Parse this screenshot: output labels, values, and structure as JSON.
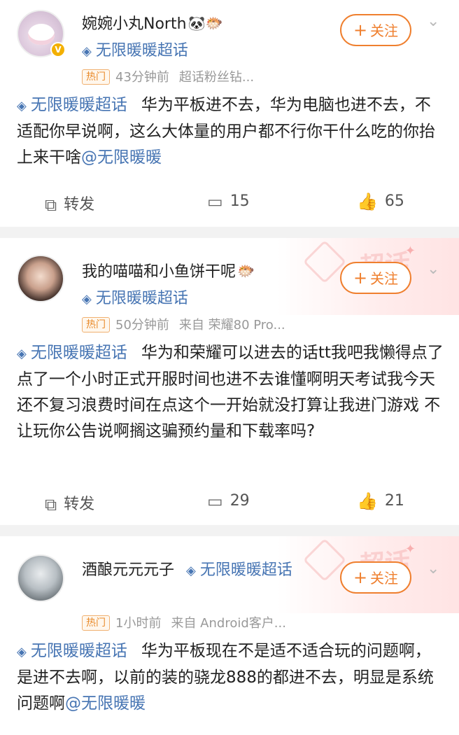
{
  "posts": [
    {
      "username": "婉婉小丸North",
      "name_emoji": "🐼🐡",
      "topic_line": "无限暖暖超话",
      "hot_tag": "热门",
      "time": "43分钟前",
      "source": "超话粉丝钻...",
      "follow_label": "关注",
      "body_topic": "无限暖暖超话",
      "body": "华为平板进不去，华为电脑也进不去，不适配你早说啊，这么大体量的用户都不行你干什么吃的你抬上来干啥",
      "mention": "@无限暖暖",
      "repost_label": "转发",
      "comments": "15",
      "likes": "65"
    },
    {
      "username": "我的喵喵和小鱼饼干呢",
      "name_emoji": "🐡",
      "topic_line": "无限暖暖超话",
      "hot_tag": "热门",
      "time": "50分钟前",
      "source": "来自 荣耀80 Pro...",
      "follow_label": "关注",
      "body_topic": "无限暖暖超话",
      "body": "华为和荣耀可以进去的话tt我吧我懒得点了 点了一个小时正式开服时间也进不去谁懂啊明天考试我今天还不复习浪费时间在点这个一开始就没打算让我进门游戏 不让玩你公告说啊搁这骗预约量和下载率吗?",
      "mention": "",
      "repost_label": "转发",
      "comments": "29",
      "likes": "21"
    },
    {
      "username": "酒酿元元元子",
      "name_emoji": "",
      "topic_line": "无限暖暖超话",
      "hot_tag": "热门",
      "time": "1小时前",
      "source": "来自 Android客户...",
      "follow_label": "关注",
      "body_topic": "无限暖暖超话",
      "body": "华为平板现在不是适不适合玩的问题啊，是进不去啊，以前的装的骁龙888的都进不去，明显是系统问题啊",
      "mention": "@无限暖暖",
      "repost_label": "转发",
      "comments": "",
      "likes": ""
    }
  ],
  "deco_text": "超话",
  "colors": {
    "link": "#4775b3",
    "follow": "#ef7f2e",
    "hot": "#e98a2a"
  },
  "icons": [
    "diamond-topic-icon",
    "repost-icon",
    "comment-icon",
    "like-icon",
    "chevron-down-icon",
    "verified-badge-icon"
  ]
}
